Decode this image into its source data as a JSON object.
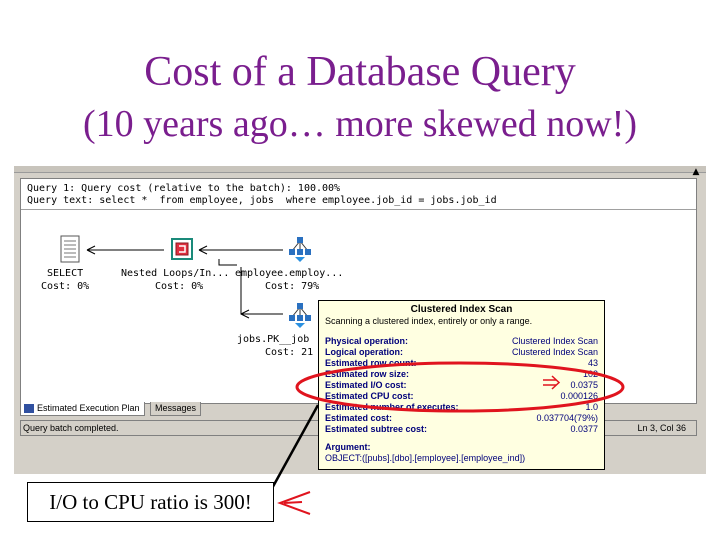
{
  "slide": {
    "title": "Cost of a Database Query",
    "subtitle": "(10 years ago… more skewed now!)"
  },
  "plan": {
    "query_line": "Query 1: Query cost (relative to the batch): 100.00%",
    "query_text": "Query text: select *  from employee, jobs  where employee.job_id = jobs.job_id",
    "nodes": [
      {
        "name": "SELECT",
        "cost": "Cost: 0%",
        "icon": "select-icon"
      },
      {
        "name": "Nested Loops/In...",
        "cost": "Cost: 0%",
        "icon": "nested-loops-icon"
      },
      {
        "name": "employee.employ...",
        "cost": "Cost: 79%",
        "icon": "clustered-index-scan-icon"
      },
      {
        "name": "jobs.PK__job",
        "cost": "Cost: 21",
        "icon": "clustered-index-seek-icon"
      }
    ]
  },
  "tabs": [
    {
      "label": "Estimated Execution Plan",
      "active": true,
      "icon": "plan-icon"
    },
    {
      "label": "Messages",
      "active": false
    }
  ],
  "status": {
    "text": "Query batch completed.",
    "position": "Ln 3, Col 36"
  },
  "tooltip": {
    "title": "Clustered Index Scan",
    "description": "Scanning a clustered index, entirely or only a range.",
    "rows": [
      {
        "label": "Physical operation:",
        "value": "Clustered Index Scan"
      },
      {
        "label": "Logical operation:",
        "value": "Clustered Index Scan"
      },
      {
        "label": "Estimated row count:",
        "value": "43"
      },
      {
        "label": "Estimated row size:",
        "value": "102"
      },
      {
        "label": "Estimated I/O cost:",
        "value": "0.0375"
      },
      {
        "label": "Estimated CPU cost:",
        "value": "0.000126"
      },
      {
        "label": "Estimated number of executes:",
        "value": "1.0"
      },
      {
        "label": "Estimated cost:",
        "value": "0.037704(79%)"
      },
      {
        "label": "Estimated subtree cost:",
        "value": "0.0377"
      }
    ],
    "argument_label": "Argument:",
    "argument_value": "OBJECT:([pubs].[dbo].[employee].[employee_ind])"
  },
  "callout": {
    "text": "I/O to CPU ratio is 300!"
  },
  "colors": {
    "title": "#7a1e8e",
    "annotation": "#e0141e",
    "tooltip_text": "#00007a",
    "tooltip_bg": "#ffffe1"
  }
}
